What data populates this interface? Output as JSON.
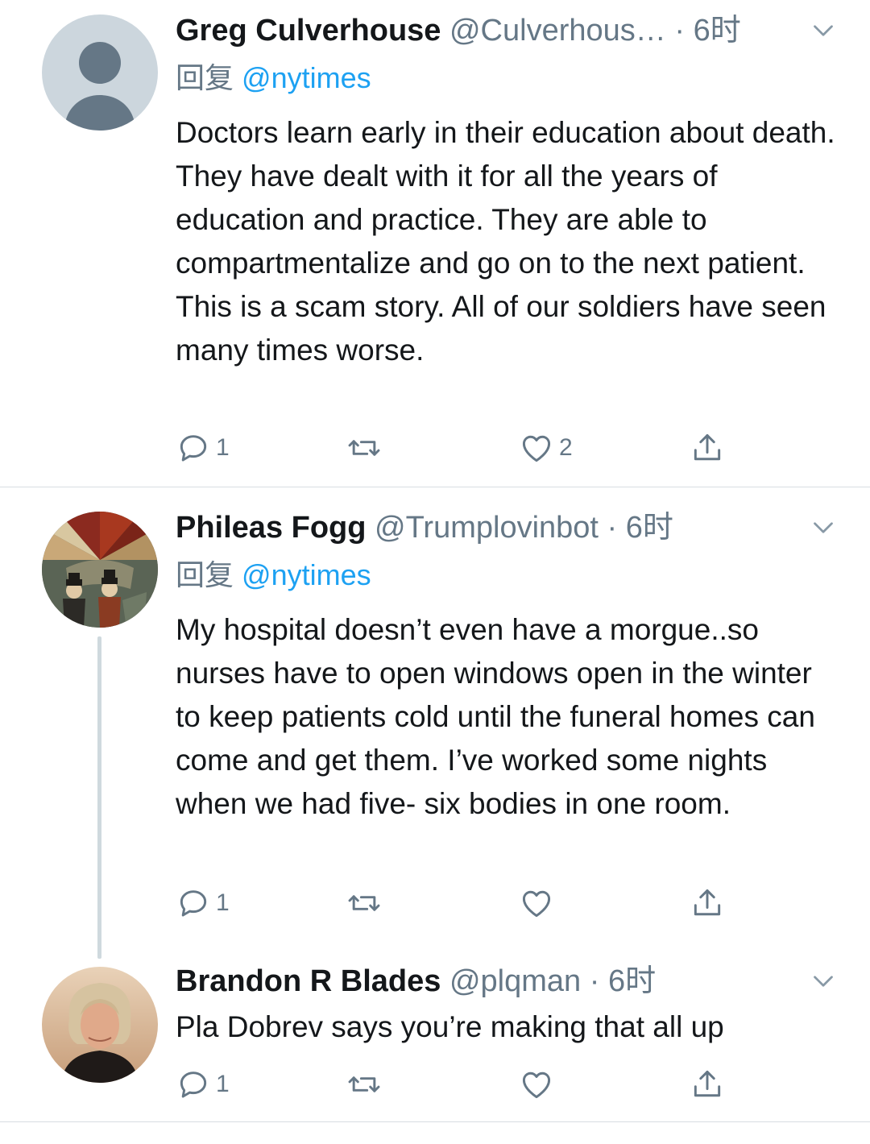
{
  "tweets": [
    {
      "name": "Greg Culverhouse",
      "handle": "@Culverhous…",
      "dot": "·",
      "time": "6时",
      "reply_prefix": "回复",
      "reply_to": "@nytimes",
      "text": "Doctors learn early in their education about death. They have dealt with it for all the years of education and practice.  They are able to compartmentalize and go on to the next patient.  This is a scam story. All of our soldiers have seen many times worse.",
      "reply_count": "1",
      "retweet_count": "",
      "like_count": "2",
      "avatar": "default-avatar"
    },
    {
      "name": "Phileas Fogg",
      "handle": "@Trumplovinbot",
      "dot": "·",
      "time": "6时",
      "reply_prefix": "回复",
      "reply_to": "@nytimes",
      "text": "My hospital doesn’t even have a morgue..so nurses have to open windows open in the winter to keep patients cold until the funeral homes can come and get them. I’ve worked some nights when we had five- six bodies in one room.",
      "reply_count": "1",
      "retweet_count": "",
      "like_count": "",
      "avatar": "balloon-illustration-avatar"
    },
    {
      "name": "Brandon R Blades",
      "handle": "@plqman",
      "dot": "·",
      "time": "6时",
      "text": "Pla Dobrev says you’re making that all up",
      "reply_count": "1",
      "retweet_count": "",
      "like_count": "",
      "avatar": "photo-avatar"
    }
  ],
  "colors": {
    "text": "#14171a",
    "secondary": "#657786",
    "link": "#1da1f2",
    "divider": "#d8dde2",
    "thread_line": "#cfd9de"
  },
  "icons": [
    "reply-icon",
    "retweet-icon",
    "like-icon",
    "share-icon",
    "chevron-down-icon"
  ]
}
